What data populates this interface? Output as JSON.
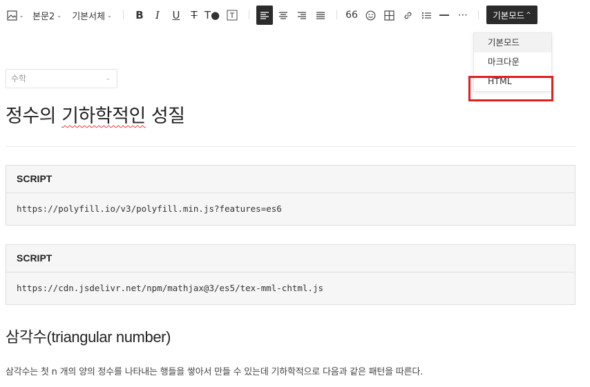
{
  "toolbar": {
    "paragraph_style": "본문2",
    "font": "기본서체",
    "mode_label": "기본모드",
    "icons": [
      "image-icon",
      "bold-icon",
      "italic-icon",
      "underline-icon",
      "strikethrough-icon",
      "text-color-icon",
      "text-background-icon",
      "align-left-icon",
      "align-center-icon",
      "align-right-icon",
      "align-justify-icon",
      "quote-icon",
      "emoticon-icon",
      "table-icon",
      "link-icon",
      "list-icon",
      "horizontal-line-icon",
      "more-icon"
    ]
  },
  "mode_dropdown": {
    "items": [
      "기본모드",
      "마크다운",
      "HTML"
    ],
    "selected": "기본모드",
    "highlighted": "HTML"
  },
  "editor": {
    "category": "수학",
    "title_before": "정수의 ",
    "title_squiggle": "기하학적인",
    "title_after": " 성질",
    "script_blocks": [
      {
        "header": "SCRIPT",
        "content": "https://polyfill.io/v3/polyfill.min.js?features=es6"
      },
      {
        "header": "SCRIPT",
        "content": "https://cdn.jsdelivr.net/npm/mathjax@3/es5/tex-mml-chtml.js"
      }
    ],
    "heading_kr": "삼각수",
    "heading_en": "(triangular number)",
    "paragraph": "삼각수는 첫 n 개의 양의 정수를 나타내는 행들을 쌓아서 만들 수 있는데 기하학적으로 다음과 같은 패턴을 따른다."
  },
  "colors": {
    "highlight_border": "#e01e1e",
    "button_dark": "#2b2b2b"
  }
}
